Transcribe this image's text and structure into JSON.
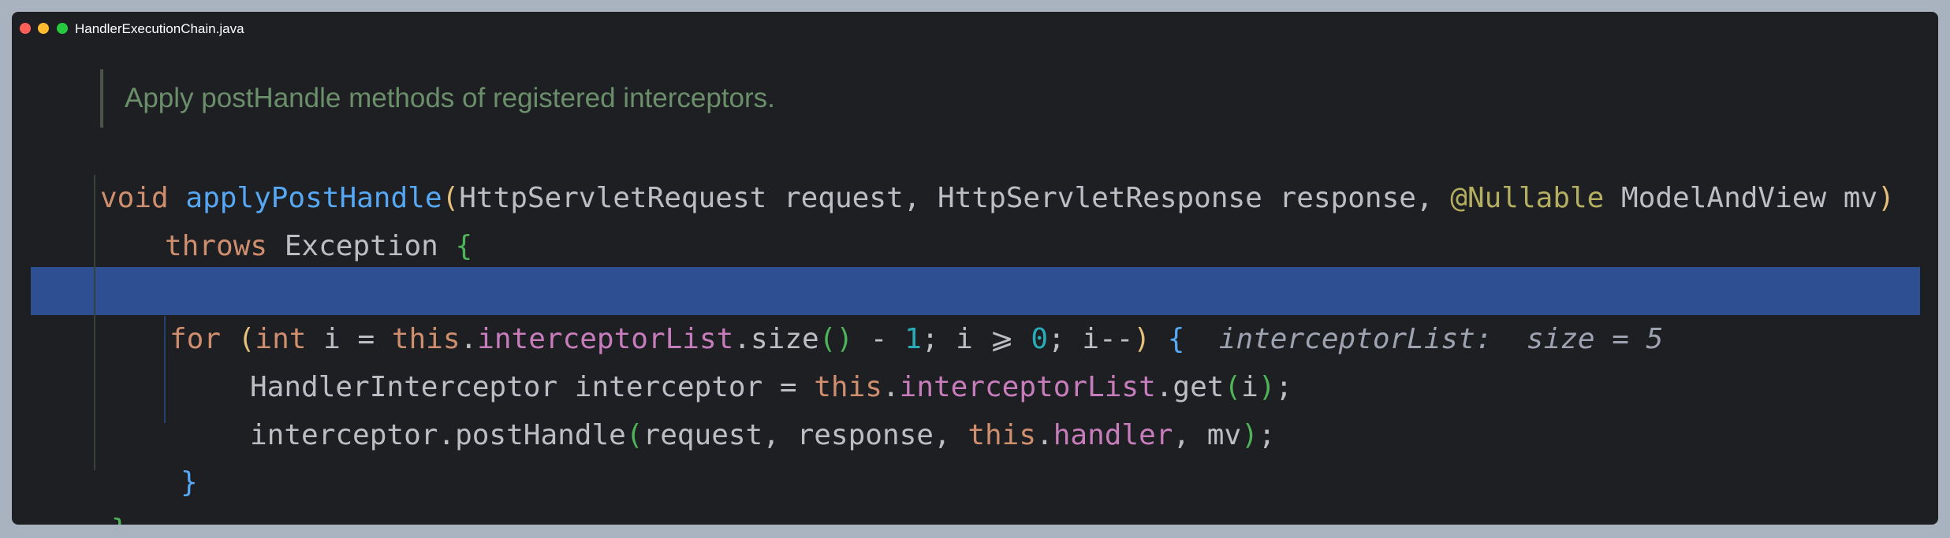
{
  "window": {
    "title": "HandlerExecutionChain.java"
  },
  "doc_comment": "Apply postHandle methods of registered interceptors.",
  "code": {
    "line1": {
      "kw_void": "void",
      "method": "applyPostHandle",
      "p_open": "(",
      "params1": "HttpServletRequest request, HttpServletResponse response, ",
      "annotation": "@Nullable",
      "params2": " ModelAndView mv",
      "p_close": ")"
    },
    "line2": {
      "kw_throws": "throws",
      "exception": " Exception ",
      "brace": "{"
    },
    "line3": {
      "kw_for": "for",
      "space": " ",
      "p_open": "(",
      "kw_int": "int",
      "t1": " i = ",
      "kw_this": "this",
      "dot": ".",
      "field": "interceptorList",
      "t2": ".size",
      "call_parens": "()",
      "t3": " - ",
      "num1": "1",
      "t4": "; i ⩾ ",
      "num0": "0",
      "t5": "; i--",
      "p_close": ")",
      "brace": " {",
      "hint": "  interceptorList:  size = 5"
    },
    "line4": {
      "t1": "HandlerInterceptor interceptor = ",
      "kw_this": "this",
      "dot": ".",
      "field": "interceptorList",
      "t2": ".get",
      "p_open": "(",
      "arg": "i",
      "p_close": ")",
      "semi": ";"
    },
    "line5": {
      "t1": "interceptor.postHandle",
      "p_open": "(",
      "t2": "request, response, ",
      "kw_this": "this",
      "dot": ".",
      "field": "handler",
      "t3": ", mv",
      "p_close": ")",
      "semi": ";"
    },
    "line6": {
      "brace": "}"
    },
    "line7": {
      "brace": "}"
    }
  },
  "colors": {
    "background": "#1e1f22",
    "highlight": "#2e4f92",
    "keyword": "#cf8e6d",
    "method": "#56a8f5",
    "field": "#c77dbb",
    "number": "#2aacb8",
    "annotation": "#b3ae60",
    "comment": "#6a8f6a"
  }
}
